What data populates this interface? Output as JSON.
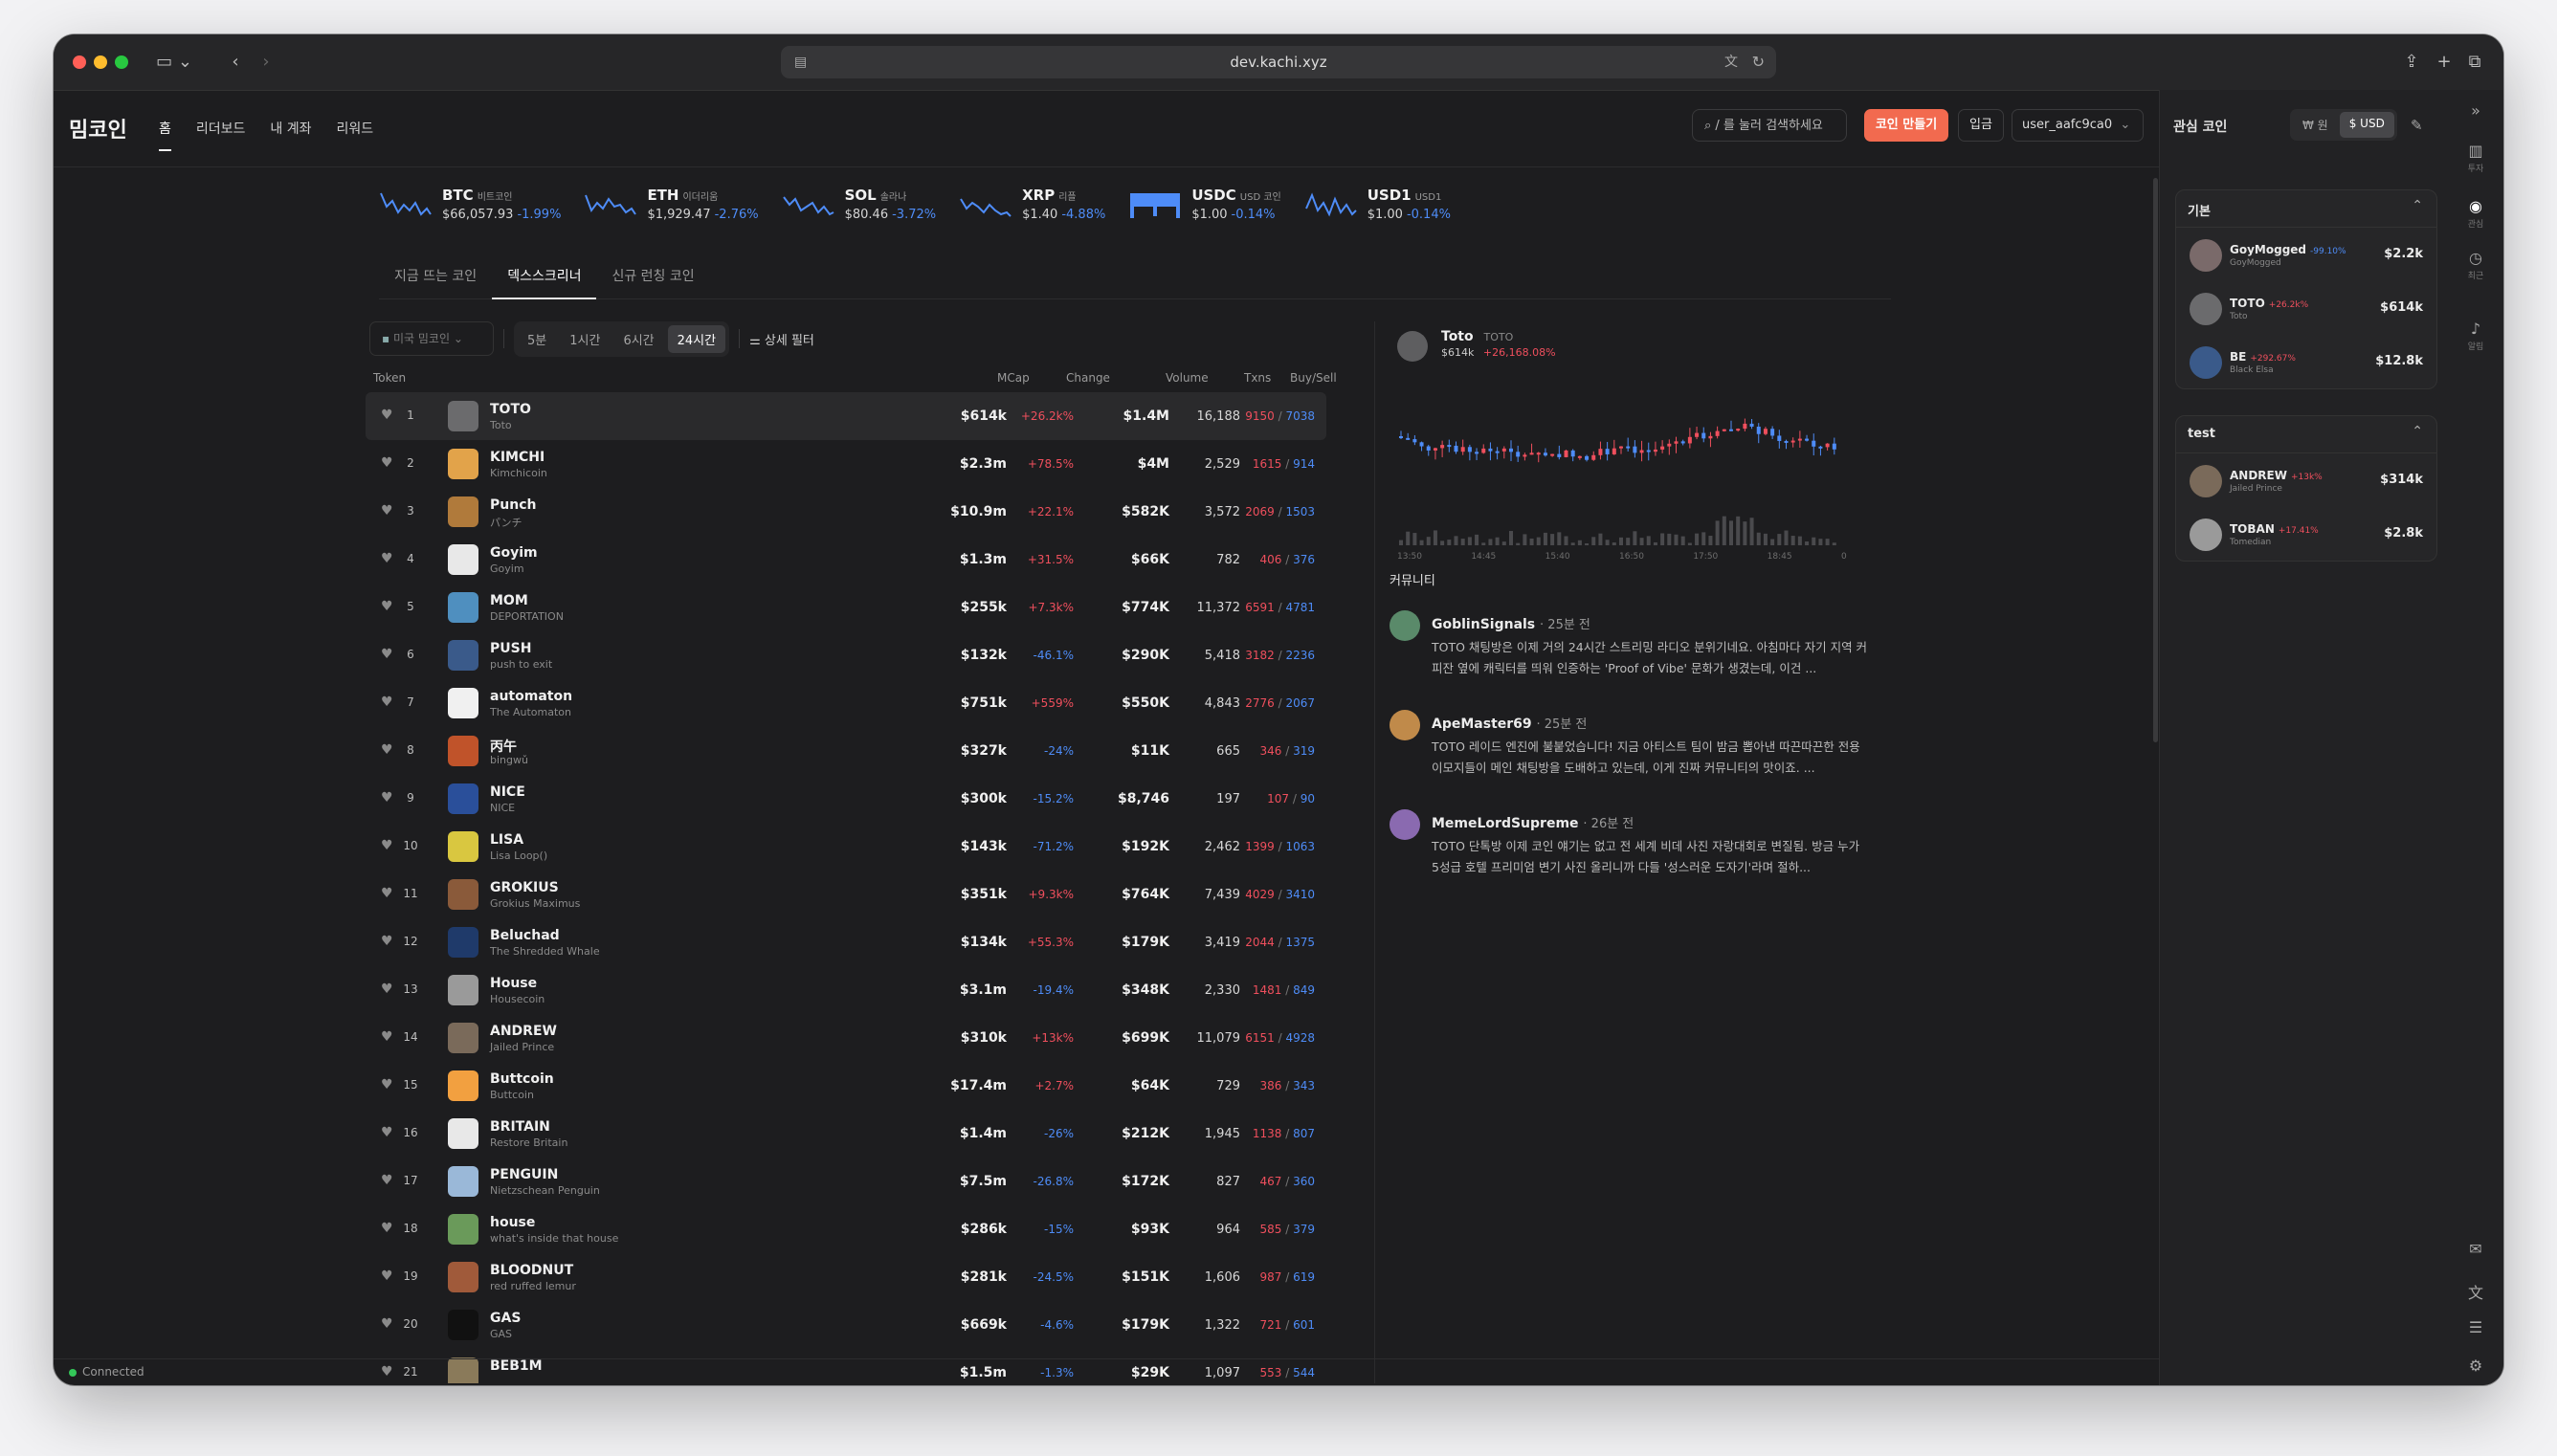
{
  "browser": {
    "url": "dev.kachi.xyz"
  },
  "header": {
    "logo": "밈코인",
    "nav": [
      "홈",
      "리더보드",
      "내 계좌",
      "리워드"
    ],
    "search_placeholder": "/ 를 눌러 검색하세요",
    "create_label": "코인 만들기",
    "deposit_label": "입금",
    "user_label": "user_aafc9ca0"
  },
  "ticker": [
    {
      "symbol": "BTC",
      "name": "비트코인",
      "price": "$66,057.93",
      "change": "-1.99%"
    },
    {
      "symbol": "ETH",
      "name": "이더리움",
      "price": "$1,929.47",
      "change": "-2.76%"
    },
    {
      "symbol": "SOL",
      "name": "솔라나",
      "price": "$80.46",
      "change": "-3.72%"
    },
    {
      "symbol": "XRP",
      "name": "리플",
      "price": "$1.40",
      "change": "-4.88%"
    },
    {
      "symbol": "USDC",
      "name": "USD 코인",
      "price": "$1.00",
      "change": "-0.14%"
    },
    {
      "symbol": "USD1",
      "name": "USD1",
      "price": "$1.00",
      "change": "-0.14%"
    }
  ],
  "tabs": [
    "지금 뜨는 코인",
    "덱스스크리너",
    "신규 런칭 코인"
  ],
  "filters": {
    "market": "미국 밈코인",
    "timeframes": [
      "5분",
      "1시간",
      "6시간",
      "24시간"
    ],
    "detail": "상세 필터"
  },
  "columns": {
    "token": "Token",
    "mcap": "MCap",
    "change": "Change",
    "volume": "Volume",
    "txns": "Txns",
    "buysell": "Buy/Sell"
  },
  "tokens": [
    {
      "rank": "1",
      "symbol": "TOTO",
      "name": "Toto",
      "mcap": "$614k",
      "change": "+26.2k%",
      "dir": "up",
      "volume": "$1.4M",
      "txns": "16,188",
      "buy": "9150",
      "sell": "7038",
      "color": "#6b6b6d"
    },
    {
      "rank": "2",
      "symbol": "KIMCHI",
      "name": "Kimchicoin",
      "mcap": "$2.3m",
      "change": "+78.5%",
      "dir": "up",
      "volume": "$4M",
      "txns": "2,529",
      "buy": "1615",
      "sell": "914",
      "color": "#e2a34a"
    },
    {
      "rank": "3",
      "symbol": "Punch",
      "name": "パンチ",
      "mcap": "$10.9m",
      "change": "+22.1%",
      "dir": "up",
      "volume": "$582K",
      "txns": "3,572",
      "buy": "2069",
      "sell": "1503",
      "color": "#b07a3b"
    },
    {
      "rank": "4",
      "symbol": "Goyim",
      "name": "Goyim",
      "mcap": "$1.3m",
      "change": "+31.5%",
      "dir": "up",
      "volume": "$66K",
      "txns": "782",
      "buy": "406",
      "sell": "376",
      "color": "#e8e8e8"
    },
    {
      "rank": "5",
      "symbol": "MOM",
      "name": "DEPORTATION",
      "mcap": "$255k",
      "change": "+7.3k%",
      "dir": "up",
      "volume": "$774K",
      "txns": "11,372",
      "buy": "6591",
      "sell": "4781",
      "color": "#4f8fbf"
    },
    {
      "rank": "6",
      "symbol": "PUSH",
      "name": "push to exit",
      "mcap": "$132k",
      "change": "-46.1%",
      "dir": "dn",
      "volume": "$290K",
      "txns": "5,418",
      "buy": "3182",
      "sell": "2236",
      "color": "#3a5a8a"
    },
    {
      "rank": "7",
      "symbol": "automaton",
      "name": "The Automaton",
      "mcap": "$751k",
      "change": "+559%",
      "dir": "up",
      "volume": "$550K",
      "txns": "4,843",
      "buy": "2776",
      "sell": "2067",
      "color": "#f0f0f0"
    },
    {
      "rank": "8",
      "symbol": "丙午",
      "name": "bingwǔ",
      "mcap": "$327k",
      "change": "-24%",
      "dir": "dn",
      "volume": "$11K",
      "txns": "665",
      "buy": "346",
      "sell": "319",
      "color": "#c0532a"
    },
    {
      "rank": "9",
      "symbol": "NICE",
      "name": "NICE",
      "mcap": "$300k",
      "change": "-15.2%",
      "dir": "dn",
      "volume": "$8,746",
      "txns": "197",
      "buy": "107",
      "sell": "90",
      "color": "#2a4f9a"
    },
    {
      "rank": "10",
      "symbol": "LISA",
      "name": "Lisa Loop()",
      "mcap": "$143k",
      "change": "-71.2%",
      "dir": "dn",
      "volume": "$192K",
      "txns": "2,462",
      "buy": "1399",
      "sell": "1063",
      "color": "#d9c740"
    },
    {
      "rank": "11",
      "symbol": "GROKIUS",
      "name": "Grokius Maximus",
      "mcap": "$351k",
      "change": "+9.3k%",
      "dir": "up",
      "volume": "$764K",
      "txns": "7,439",
      "buy": "4029",
      "sell": "3410",
      "color": "#8a5a3a"
    },
    {
      "rank": "12",
      "symbol": "Beluchad",
      "name": "The Shredded Whale",
      "mcap": "$134k",
      "change": "+55.3%",
      "dir": "up",
      "volume": "$179K",
      "txns": "3,419",
      "buy": "2044",
      "sell": "1375",
      "color": "#1f3a6a"
    },
    {
      "rank": "13",
      "symbol": "House",
      "name": "Housecoin",
      "mcap": "$3.1m",
      "change": "-19.4%",
      "dir": "dn",
      "volume": "$348K",
      "txns": "2,330",
      "buy": "1481",
      "sell": "849",
      "color": "#9a9a9a"
    },
    {
      "rank": "14",
      "symbol": "ANDREW",
      "name": "Jailed Prince",
      "mcap": "$310k",
      "change": "+13k%",
      "dir": "up",
      "volume": "$699K",
      "txns": "11,079",
      "buy": "6151",
      "sell": "4928",
      "color": "#7a6a5a"
    },
    {
      "rank": "15",
      "symbol": "Buttcoin",
      "name": "Buttcoin",
      "mcap": "$17.4m",
      "change": "+2.7%",
      "dir": "up",
      "volume": "$64K",
      "txns": "729",
      "buy": "386",
      "sell": "343",
      "color": "#f2a040"
    },
    {
      "rank": "16",
      "symbol": "BRITAIN",
      "name": "Restore Britain",
      "mcap": "$1.4m",
      "change": "-26%",
      "dir": "dn",
      "volume": "$212K",
      "txns": "1,945",
      "buy": "1138",
      "sell": "807",
      "color": "#e8e8e8"
    },
    {
      "rank": "17",
      "symbol": "PENGUIN",
      "name": "Nietzschean Penguin",
      "mcap": "$7.5m",
      "change": "-26.8%",
      "dir": "dn",
      "volume": "$172K",
      "txns": "827",
      "buy": "467",
      "sell": "360",
      "color": "#9ab8d8"
    },
    {
      "rank": "18",
      "symbol": "house",
      "name": "what's inside that house",
      "mcap": "$286k",
      "change": "-15%",
      "dir": "dn",
      "volume": "$93K",
      "txns": "964",
      "buy": "585",
      "sell": "379",
      "color": "#6a9a5a"
    },
    {
      "rank": "19",
      "symbol": "BLOODNUT",
      "name": "red ruffed lemur",
      "mcap": "$281k",
      "change": "-24.5%",
      "dir": "dn",
      "volume": "$151K",
      "txns": "1,606",
      "buy": "987",
      "sell": "619",
      "color": "#a05a3a"
    },
    {
      "rank": "20",
      "symbol": "GAS",
      "name": "GAS",
      "mcap": "$669k",
      "change": "-4.6%",
      "dir": "dn",
      "volume": "$179K",
      "txns": "1,322",
      "buy": "721",
      "sell": "601",
      "color": "#111111"
    },
    {
      "rank": "21",
      "symbol": "BEB1M",
      "name": "",
      "mcap": "$1.5m",
      "change": "-1.3%",
      "dir": "dn",
      "volume": "$29K",
      "txns": "1,097",
      "buy": "553",
      "sell": "544",
      "color": "#8a7a5a"
    }
  ],
  "detail": {
    "name": "Toto",
    "ticker": "TOTO",
    "mcap": "$614k",
    "change": "+26,168.08%",
    "time_labels": [
      "13:50",
      "14:45",
      "15:40",
      "16:50",
      "17:50",
      "18:45",
      "0"
    ]
  },
  "community": {
    "title": "커뮤니티",
    "posts": [
      {
        "author": "GoblinSignals",
        "time": "25분 전",
        "body": "TOTO 채팅방은 이제 거의 24시간 스트리밍 라디오 분위기네요. 아침마다 자기 지역 커피잔 옆에 캐릭터를 띄워 인증하는 'Proof of Vibe' 문화가 생겼는데, 이건 ...",
        "color": "#5a8a6a"
      },
      {
        "author": "ApeMaster69",
        "time": "25분 전",
        "body": "TOTO 레이드 엔진에 불붙었습니다! 지금 아티스트 팀이 밤금 뽑아낸 따끈따끈한 전용 이모지들이 메인 채팅방을 도배하고 있는데, 이게 진짜 커뮤니티의 맛이죠. ...",
        "color": "#c08a4a"
      },
      {
        "author": "MemeLordSupreme",
        "time": "26분 전",
        "body": "TOTO 단톡방 이제 코인 얘기는 없고 전 세계 비데 사진 자랑대회로 변질됨. 방금 누가 5성급 호텔 프리미엄 변기 사진 올리니까 다들 '성스러운 도자기'라며 절하...",
        "color": "#8a6ab0"
      }
    ]
  },
  "watchlist": {
    "title": "관심 코인",
    "currency": [
      "₩ 원",
      "$ USD"
    ],
    "groups": [
      {
        "name": "기본",
        "items": [
          {
            "symbol": "GoyMogged",
            "pct": "-99.10%",
            "dir": "dn",
            "name": "GoyMogged",
            "value": "$2.2k",
            "color": "#7a6a6a"
          },
          {
            "symbol": "TOTO",
            "pct": "+26.2k%",
            "dir": "up",
            "name": "Toto",
            "value": "$614k",
            "color": "#6b6b6d"
          },
          {
            "symbol": "BE",
            "pct": "+292.67%",
            "dir": "up",
            "name": "Black Elsa",
            "value": "$12.8k",
            "color": "#3a5a8a"
          }
        ]
      },
      {
        "name": "test",
        "items": [
          {
            "symbol": "ANDREW",
            "pct": "+13k%",
            "dir": "up",
            "name": "Jailed Prince",
            "value": "$314k",
            "color": "#7a6a5a"
          },
          {
            "symbol": "TOBAN",
            "pct": "+17.41%",
            "dir": "up",
            "name": "Tomedian",
            "value": "$2.8k",
            "color": "#9a9a9a"
          }
        ]
      }
    ]
  },
  "rail": [
    "투자",
    "관심",
    "최근",
    "알림"
  ],
  "status": "Connected"
}
